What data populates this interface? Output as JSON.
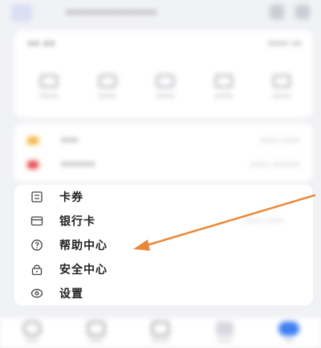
{
  "header": {
    "title": "••••••••••••••••",
    "icons": [
      "app-logo-icon",
      "scan-icon",
      "settings-icon"
    ]
  },
  "assets_card": {
    "left_text": "•• ••",
    "right_text": "•••• ••",
    "quick_actions": [
      {
        "label": "••••",
        "icon": "card-icon"
      },
      {
        "label": "••••",
        "icon": "wallet-icon"
      },
      {
        "label": "••••",
        "icon": "coupon-icon"
      },
      {
        "label": "••••",
        "icon": "bill-icon"
      },
      {
        "label": "••••",
        "icon": "more-icon"
      }
    ]
  },
  "promo_card": {
    "rows": [
      {
        "label": "•••",
        "right": "•••• ••••",
        "color": "#f2b53c"
      },
      {
        "label": "••••••",
        "right": "•••• ••••••",
        "color": "#e64545"
      }
    ]
  },
  "menu": {
    "items": [
      {
        "label": "卡券",
        "right": "",
        "icon": "coupon-icon"
      },
      {
        "label": "银行卡",
        "right": "•••• ••••",
        "icon": "bank-card-icon"
      },
      {
        "label": "帮助中心",
        "right": "",
        "icon": "help-icon"
      },
      {
        "label": "安全中心",
        "right": "",
        "icon": "lock-icon"
      },
      {
        "label": "设置",
        "right": "",
        "icon": "settings-icon"
      }
    ]
  },
  "tabbar": {
    "tabs": [
      {
        "label": "•••",
        "icon": "home-icon"
      },
      {
        "label": "•••",
        "icon": "wealth-icon"
      },
      {
        "label": "••••",
        "icon": "life-icon"
      },
      {
        "label": "•••",
        "icon": "discover-icon"
      },
      {
        "label": "••",
        "icon": "me-icon"
      }
    ]
  },
  "annotation": {
    "arrow_color": "#e8893a",
    "points_to": "帮助中心"
  }
}
